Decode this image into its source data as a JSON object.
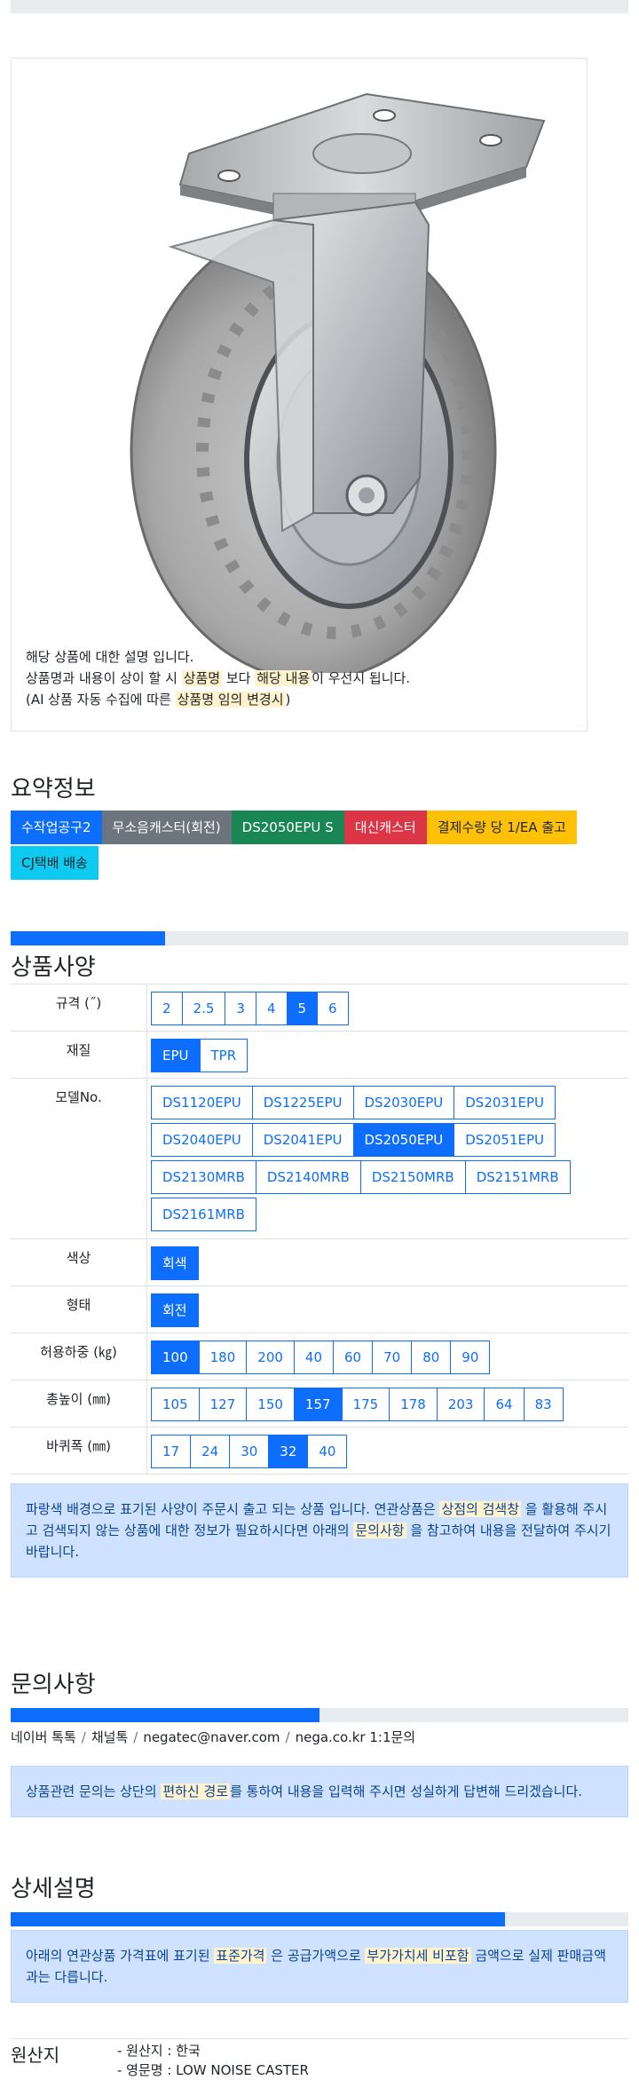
{
  "description": {
    "line1": "해당 상품에 대한 설명 입니다.",
    "line2_a": "상품명과 내용이 상이 할 시 ",
    "line2_hl1": "상품명",
    "line2_b": " 보다 ",
    "line2_hl2": "해당 내용",
    "line2_c": "이 우선시 됩니다.",
    "line3_a": "(AI 상품 자동 수집에 따른 ",
    "line3_hl": "상품명 임의 변경시",
    "line3_b": ")"
  },
  "summary": {
    "title": "요약정보",
    "tags": [
      {
        "label": "수작업공구2",
        "color": "#0d6efd"
      },
      {
        "label": "무소음캐스터(회전)",
        "color": "#6c757d"
      },
      {
        "label": "DS2050EPU S",
        "color": "#198754"
      },
      {
        "label": "대신캐스터",
        "color": "#dc3545"
      },
      {
        "label": "결제수량 당 1/EA 출고",
        "color": "#ffc107"
      },
      {
        "label": "CJ택배 배송",
        "color": "#0dcaf0"
      }
    ]
  },
  "spec": {
    "title": "상품사양",
    "progress": 0.25,
    "rows": [
      {
        "label": "규격 (˝)",
        "options": [
          "2",
          "2.5",
          "3",
          "4",
          "5",
          "6"
        ],
        "selected": "5"
      },
      {
        "label": "재질",
        "options": [
          "EPU",
          "TPR"
        ],
        "selected": "EPU"
      },
      {
        "label": "모델No.",
        "options": [
          "DS1120EPU",
          "DS1225EPU",
          "DS2030EPU",
          "DS2031EPU",
          "DS2040EPU",
          "DS2041EPU",
          "DS2050EPU",
          "DS2051EPU",
          "DS2130MRB",
          "DS2140MRB",
          "DS2150MRB",
          "DS2151MRB",
          "DS2161MRB"
        ],
        "selected": "DS2050EPU"
      },
      {
        "label": "색상",
        "options": [
          "회색"
        ],
        "selected": "회색"
      },
      {
        "label": "형태",
        "options": [
          "회전"
        ],
        "selected": "회전"
      },
      {
        "label": "허용하중 (㎏)",
        "options": [
          "100",
          "180",
          "200",
          "40",
          "60",
          "70",
          "80",
          "90"
        ],
        "selected": "100"
      },
      {
        "label": "총높이 (㎜)",
        "options": [
          "105",
          "127",
          "150",
          "157",
          "175",
          "178",
          "203",
          "64",
          "83"
        ],
        "selected": "157"
      },
      {
        "label": "바퀴폭 (㎜)",
        "options": [
          "17",
          "24",
          "30",
          "32",
          "40"
        ],
        "selected": "32"
      }
    ],
    "notice_a": "파랑색 배경으로 표기된 사양이 주문시 출고 되는 상품 입니다. 연관상품은 ",
    "notice_hl1": "상점의 검색창",
    "notice_b": " 을 활용해 주시고 검색되지 않는 상품에 대한 정보가 필요하시다면 아래의 ",
    "notice_hl2": "문의사항",
    "notice_c": " 을 참고하여 내용을 전달하여 주시기 바랍니다."
  },
  "inquiry": {
    "title": "문의사항",
    "progress": 0.5,
    "links": [
      "네이버 톡톡",
      "채널톡",
      "negatec@naver.com",
      "nega.co.kr 1:1문의"
    ],
    "separator": "/",
    "notice_a": "상품관련 문의는 상단의 ",
    "notice_hl": "편하신 경로",
    "notice_b": "를 통하여 내용을 입력해 주시면 성실하게 답변해 드리겠습니다."
  },
  "detail": {
    "title": "상세설명",
    "progress": 0.8,
    "notice_a": "아래의 연관상품 가격표에 표기된 ",
    "notice_hl1": "표준가격",
    "notice_b": " 은 공급가액으로 ",
    "notice_hl2": "부가가치세 비포함",
    "notice_c": " 금액으로 실제 판매금액과는 다릅니다."
  },
  "origin": {
    "title": "원산지",
    "items": [
      "- 원산지 : 한국",
      "- 영문명 : LOW NOISE CASTER"
    ]
  }
}
